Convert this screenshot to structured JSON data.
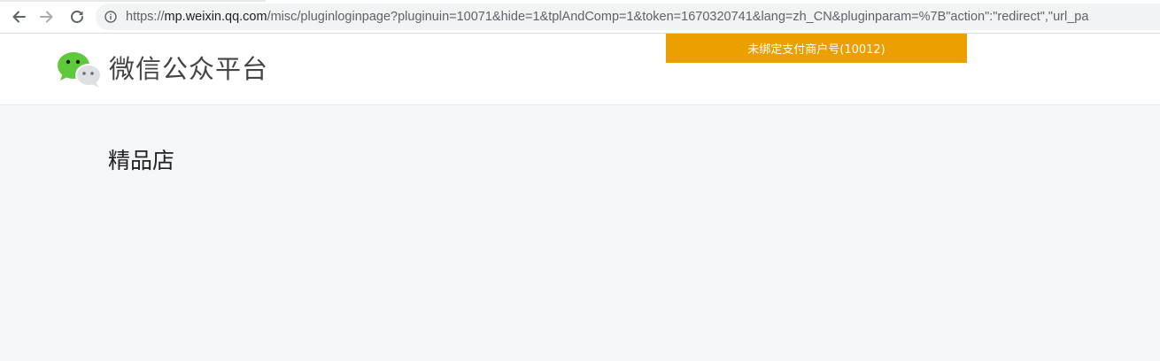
{
  "browser": {
    "back_icon": "back-arrow-icon",
    "forward_icon": "forward-arrow-icon",
    "reload_icon": "reload-icon",
    "info_icon": "info-icon",
    "url_scheme": "https://",
    "url_host": "mp.weixin.qq.com",
    "url_rest": "/misc/pluginloginpage?pluginuin=10071&hide=1&tplAndComp=1&token=1670320741&lang=zh_CN&pluginparam=%7B\"action\":\"redirect\",\"url_pa"
  },
  "header": {
    "logo_icon": "wechat-logo-icon",
    "logo_text": "微信公众平台",
    "logo_colors": {
      "green": "#5fc93c",
      "grey": "#dfe0e4"
    }
  },
  "alert": {
    "text": "未绑定支付商户号(10012)",
    "color": "#eca000"
  },
  "main": {
    "title": "精品店"
  }
}
